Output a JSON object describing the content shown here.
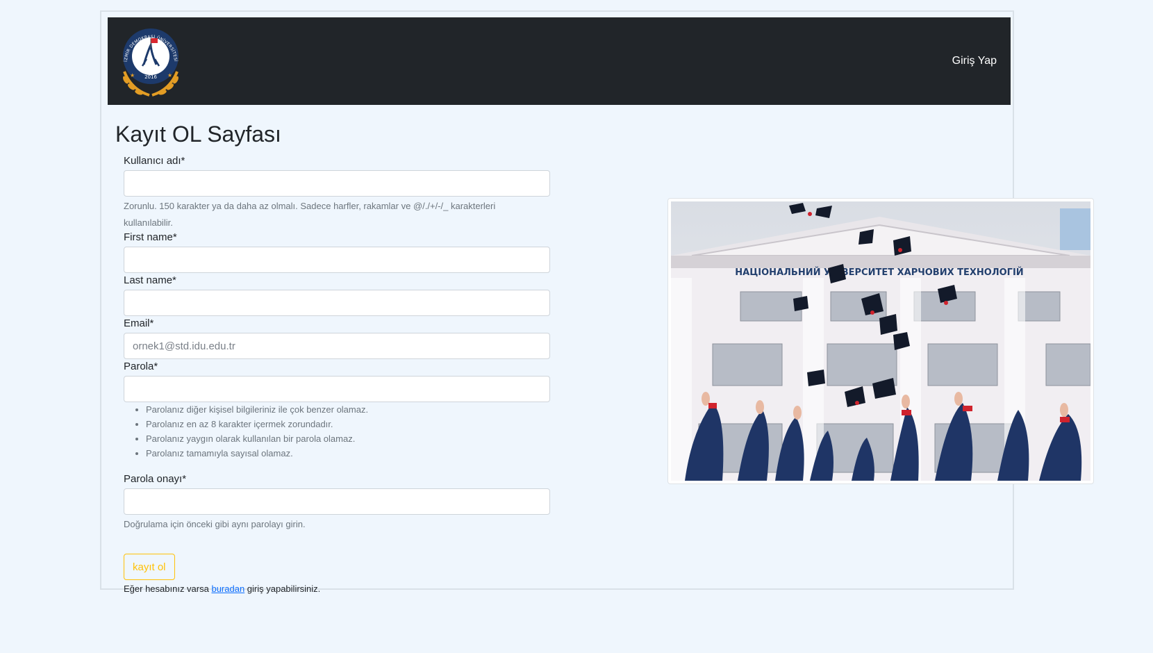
{
  "header": {
    "logo": {
      "top_text": "İZMİR DEMOKRASİ ÜNİVERSİTESİ",
      "year": "2016"
    },
    "login_link": "Giriş Yap"
  },
  "page": {
    "title": "Kayıt OL Sayfası"
  },
  "form": {
    "username": {
      "label": "Kullanıcı adı*",
      "value": "",
      "help": "Zorunlu. 150 karakter ya da daha az olmalı. Sadece harfler, rakamlar ve @/./+/-/_ karakterleri kullanılabilir."
    },
    "first_name": {
      "label": "First name*",
      "value": ""
    },
    "last_name": {
      "label": "Last name*",
      "value": ""
    },
    "email": {
      "label": "Email*",
      "value": "",
      "placeholder": "ornek1@std.idu.edu.tr"
    },
    "password": {
      "label": "Parola*",
      "value": "",
      "rules": [
        "Parolanız diğer kişisel bilgileriniz ile çok benzer olamaz.",
        "Parolanız en az 8 karakter içermek zorundadır.",
        "Parolanız yaygın olarak kullanılan bir parola olamaz.",
        "Parolanız tamamıyla sayısal olamaz."
      ]
    },
    "password_confirm": {
      "label": "Parola onayı*",
      "value": "",
      "help": "Doğrulama için önceki gibi aynı parolayı girin."
    },
    "submit_label": "kayıt ol",
    "login_hint": {
      "before": "Eğer hesabınız varsa ",
      "link": "buradan",
      "after": " giriş yapabilirsiniz."
    }
  },
  "image": {
    "building_sign": "НАЦІОНАЛЬНИЙ УНІВЕРСИТЕТ ХАРЧОВИХ ТЕХНОЛОГІЙ"
  },
  "colors": {
    "background": "#eff6fd",
    "navbar": "#212529",
    "warning": "#ffc107",
    "link": "#0d6efd"
  }
}
